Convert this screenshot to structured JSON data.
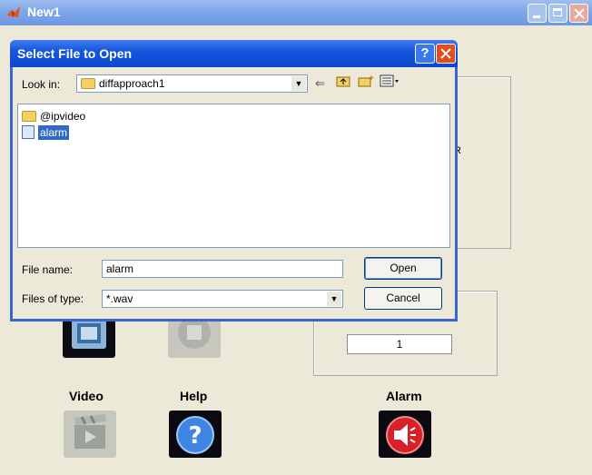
{
  "main_window": {
    "title": "New1",
    "panel_label": "R",
    "value_field": "1",
    "buttons": [
      {
        "label": "Video",
        "icon": "video-clapper-icon"
      },
      {
        "label": "Help",
        "icon": "question-mark-icon"
      },
      {
        "label": "Alarm",
        "icon": "speaker-icon"
      }
    ]
  },
  "dialog": {
    "title": "Select File to Open",
    "help_button": "?",
    "look_in_label": "Look in:",
    "look_in_value": "diffapproach1",
    "files": [
      {
        "name": "@ipvideo",
        "type": "folder",
        "selected": false
      },
      {
        "name": "alarm",
        "type": "wav",
        "selected": true
      }
    ],
    "file_name_label": "File name:",
    "file_name_value": "alarm",
    "files_of_type_label": "Files of type:",
    "files_of_type_value": "*.wav",
    "open_button": "Open",
    "cancel_button": "Cancel"
  },
  "colors": {
    "titlebar_active": "#0a49d0",
    "titlebar_inactive": "#7ea6ea",
    "selection": "#316ac5",
    "window_bg": "#ece9d8"
  }
}
